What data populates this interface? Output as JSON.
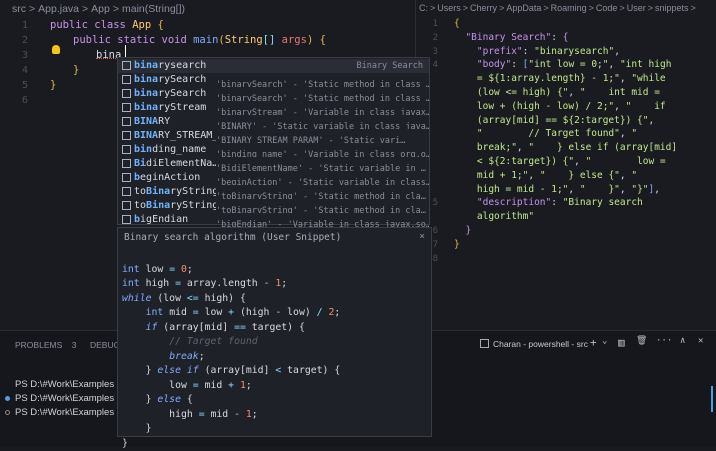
{
  "left_editor": {
    "breadcrumb": [
      "src",
      ">",
      "App.java",
      ">",
      "App",
      ">",
      "main(String[])"
    ],
    "lines": [
      {
        "n": "1",
        "ind": 0,
        "seg": [
          [
            "kw",
            "public class "
          ],
          [
            "cl",
            "App "
          ],
          [
            "br",
            "{"
          ]
        ]
      },
      {
        "n": "2",
        "ind": 1,
        "seg": [
          [
            "kw",
            "public static void "
          ],
          [
            "ty",
            "main"
          ],
          [
            "br",
            "("
          ],
          [
            "cl",
            "String"
          ],
          [
            "pu",
            "[] "
          ],
          [
            "pa",
            "args"
          ],
          [
            "br",
            ") {"
          ]
        ]
      },
      {
        "n": "3",
        "ind": 2,
        "seg": [
          [
            "sv",
            "bina"
          ]
        ]
      },
      {
        "n": "4",
        "ind": 1,
        "seg": [
          [
            "br",
            "}"
          ]
        ]
      },
      {
        "n": "5",
        "ind": 0,
        "seg": [
          [
            "br",
            "}"
          ]
        ]
      },
      {
        "n": "6",
        "ind": 0,
        "seg": []
      }
    ]
  },
  "suggestions": [
    {
      "label": "binarysearch",
      "match": 4,
      "detail": "",
      "right": "Binary Search"
    },
    {
      "label": "binarySearch",
      "match": 4,
      "detail": "'binarySearch' - 'Static method in class …"
    },
    {
      "label": "binarySearch",
      "match": 4,
      "detail": "'binarySearch' - 'Static method in class …"
    },
    {
      "label": "binaryStream",
      "match": 4,
      "detail": "'binaryStream' - 'Variable in class javax…"
    },
    {
      "label": "BINARY",
      "match": 4,
      "detail": "'BINARY' - 'Static variable in class java…"
    },
    {
      "label": "BINARY_STREAM_PA…",
      "match": 4,
      "detail": "'BINARY_STREAM_PARAM' - 'Static vari…"
    },
    {
      "label": "binding_name",
      "match": 3,
      "detail": "'binding_name' - 'Variable in class org.o…"
    },
    {
      "label": "BidiElementNa…",
      "match": 2,
      "detail": "'BidiElementName' - 'Static variable in …"
    },
    {
      "label": "beginAction",
      "match": 1,
      "detail": "'beginAction' - 'Static variable in class…"
    },
    {
      "label": "toBinaryString",
      "match": 0,
      "detail": "'toBinaryString' - 'Static method in cla…"
    },
    {
      "label": "toBinaryString",
      "match": 0,
      "detail": "'toBinaryString' - 'Static method in cla…"
    },
    {
      "label": "bigEndian",
      "match": 1,
      "detail": "'bigEndian' - 'Variable in class javax.so…"
    }
  ],
  "details": {
    "title": "Binary search algorithm (User Snippet)",
    "close": "×",
    "lines": [
      [],
      [
        [
          "ty",
          "int "
        ],
        [
          "sv",
          "low "
        ],
        [
          "pu",
          "= "
        ],
        [
          "nu",
          "0"
        ],
        [
          "sv",
          ";"
        ]
      ],
      [
        [
          "ty",
          "int "
        ],
        [
          "sv",
          "high "
        ],
        [
          "pu",
          "= "
        ],
        [
          "sv",
          "array.length "
        ],
        [
          "pu",
          "- "
        ],
        [
          "nu",
          "1"
        ],
        [
          "sv",
          ";"
        ]
      ],
      [
        [
          "it",
          "while "
        ],
        [
          "sv",
          "(low "
        ],
        [
          "pu",
          "<= "
        ],
        [
          "sv",
          "high) {"
        ]
      ],
      [
        [
          "sv",
          "    "
        ],
        [
          "ty",
          "int "
        ],
        [
          "sv",
          "mid "
        ],
        [
          "pu",
          "= "
        ],
        [
          "sv",
          "low "
        ],
        [
          "pu",
          "+ "
        ],
        [
          "sv",
          "(high "
        ],
        [
          "pu",
          "- "
        ],
        [
          "sv",
          "low) "
        ],
        [
          "pu",
          "/ "
        ],
        [
          "nu",
          "2"
        ],
        [
          "sv",
          ";"
        ]
      ],
      [
        [
          "sv",
          "    "
        ],
        [
          "it",
          "if "
        ],
        [
          "sv",
          "(array[mid] "
        ],
        [
          "pu",
          "== "
        ],
        [
          "sv",
          "target) {"
        ]
      ],
      [
        [
          "sv",
          "        "
        ],
        [
          "cm",
          "// Target found"
        ]
      ],
      [
        [
          "sv",
          "        "
        ],
        [
          "it",
          "break"
        ],
        [
          "sv",
          ";"
        ]
      ],
      [
        [
          "sv",
          "    } "
        ],
        [
          "it",
          "else if "
        ],
        [
          "sv",
          "(array[mid] "
        ],
        [
          "pu",
          "< "
        ],
        [
          "sv",
          "target) {"
        ]
      ],
      [
        [
          "sv",
          "        low "
        ],
        [
          "pu",
          "= "
        ],
        [
          "sv",
          "mid "
        ],
        [
          "pu",
          "+ "
        ],
        [
          "nu",
          "1"
        ],
        [
          "sv",
          ";"
        ]
      ],
      [
        [
          "sv",
          "    } "
        ],
        [
          "it",
          "else "
        ],
        [
          "sv",
          "{"
        ]
      ],
      [
        [
          "sv",
          "        high "
        ],
        [
          "pu",
          "= "
        ],
        [
          "sv",
          "mid "
        ],
        [
          "pu",
          "- "
        ],
        [
          "nu",
          "1"
        ],
        [
          "sv",
          ";"
        ]
      ],
      [
        [
          "sv",
          "    }"
        ]
      ],
      [
        [
          "sv",
          "}"
        ]
      ]
    ]
  },
  "right_editor": {
    "breadcrumb": [
      "C:",
      ">",
      "Users",
      ">",
      "Cherry",
      ">",
      "AppData",
      ">",
      "Roaming",
      ">",
      "Code",
      ">",
      "User",
      ">",
      "snippets",
      ">"
    ],
    "lines": [
      {
        "n": "1",
        "seg": [
          [
            "br",
            "{"
          ]
        ]
      },
      {
        "n": "2",
        "seg": [
          [
            "sv",
            "  "
          ],
          [
            "key",
            "\"Binary Search\""
          ],
          [
            "sv",
            ": "
          ],
          [
            "kw",
            "{"
          ]
        ]
      },
      {
        "n": "3",
        "seg": [
          [
            "sv",
            "    "
          ],
          [
            "key",
            "\"prefix\""
          ],
          [
            "sv",
            ": "
          ],
          [
            "st",
            "\"binarysearch\""
          ],
          [
            "sv",
            ","
          ]
        ]
      },
      {
        "n": "4",
        "seg": [
          [
            "sv",
            "    "
          ],
          [
            "key",
            "\"body\""
          ],
          [
            "sv",
            ": "
          ],
          [
            "ty",
            "["
          ],
          [
            "st",
            "\"int low = 0;\""
          ],
          [
            "sv",
            ", "
          ],
          [
            "st",
            "\"int high"
          ]
        ]
      },
      {
        "n": "",
        "seg": [
          [
            "st",
            "    = ${1:array.length} - 1;\""
          ],
          [
            "sv",
            ", "
          ],
          [
            "st",
            "\"while"
          ]
        ]
      },
      {
        "n": "",
        "seg": [
          [
            "st",
            "    (low <= high) {\""
          ],
          [
            "sv",
            ", "
          ],
          [
            "st",
            "\"    int mid ="
          ]
        ]
      },
      {
        "n": "",
        "seg": [
          [
            "st",
            "    low + (high - low) / 2;\""
          ],
          [
            "sv",
            ", "
          ],
          [
            "st",
            "\"    if"
          ]
        ]
      },
      {
        "n": "",
        "seg": [
          [
            "st",
            "    (array[mid] == ${2:target}) {\""
          ],
          [
            "sv",
            ","
          ]
        ]
      },
      {
        "n": "",
        "seg": [
          [
            "st",
            "    \"        // Target found\""
          ],
          [
            "sv",
            ", "
          ],
          [
            "st",
            "\""
          ]
        ]
      },
      {
        "n": "",
        "seg": [
          [
            "st",
            "    break;\""
          ],
          [
            "sv",
            ", "
          ],
          [
            "st",
            "\"    } else if (array[mid]"
          ]
        ]
      },
      {
        "n": "",
        "seg": [
          [
            "st",
            "    < ${2:target}) {\""
          ],
          [
            "sv",
            ", "
          ],
          [
            "st",
            "\"        low ="
          ]
        ]
      },
      {
        "n": "",
        "seg": [
          [
            "st",
            "    mid + 1;\""
          ],
          [
            "sv",
            ", "
          ],
          [
            "st",
            "\"    } else {\""
          ],
          [
            "sv",
            ", "
          ],
          [
            "st",
            "\""
          ]
        ]
      },
      {
        "n": "",
        "seg": [
          [
            "st",
            "    high = mid - 1;\""
          ],
          [
            "sv",
            ", "
          ],
          [
            "st",
            "\"    }\""
          ],
          [
            "sv",
            ", "
          ],
          [
            "st",
            "\"}\""
          ],
          [
            "ty",
            "]"
          ],
          [
            "sv",
            ","
          ]
        ]
      },
      {
        "n": "5",
        "seg": [
          [
            "sv",
            "    "
          ],
          [
            "key",
            "\"description\""
          ],
          [
            "sv",
            ": "
          ],
          [
            "st",
            "\"Binary search"
          ]
        ]
      },
      {
        "n": "",
        "seg": [
          [
            "st",
            "    algorithm\""
          ]
        ]
      },
      {
        "n": "6",
        "seg": [
          [
            "sv",
            "  "
          ],
          [
            "kw",
            "}"
          ]
        ]
      },
      {
        "n": "7",
        "seg": [
          [
            "br",
            "}"
          ]
        ]
      },
      {
        "n": "8",
        "seg": []
      }
    ]
  },
  "panel": {
    "tabs": [
      {
        "label": "PROBLEMS",
        "badge": "3"
      },
      {
        "label": "DEBUG"
      }
    ],
    "terminal_name": "Charan - powershell - src",
    "terminal_lines": [
      "PS D:\\#Work\\Examples",
      "PS D:\\#Work\\Examples",
      "PS D:\\#Work\\Examples"
    ],
    "toolbar": [
      "+",
      "⌄",
      "▥",
      "🗑",
      "···",
      "∧",
      "✕"
    ]
  }
}
